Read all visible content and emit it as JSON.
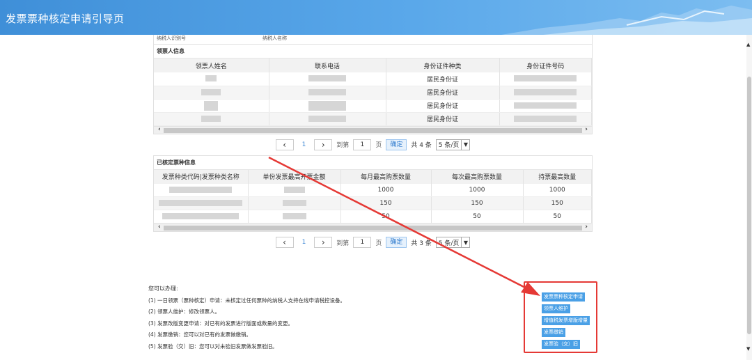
{
  "header": {
    "title": "发票票种核定申请引导页"
  },
  "top_row": {
    "col1": "纳税人识别号",
    "col2": "纳税人名称"
  },
  "receiver": {
    "title": "领票人信息",
    "columns": [
      "领票人姓名",
      "联系电话",
      "身份证件种类",
      "身份证件号码"
    ],
    "rows": [
      {
        "id_type": "居民身份证"
      },
      {
        "id_type": "居民身份证"
      },
      {
        "id_type": "居民身份证"
      },
      {
        "id_type": "居民身份证"
      }
    ],
    "pager": {
      "page": "1",
      "goto_label": "到第",
      "page_input": "1",
      "page_unit": "页",
      "ok": "确定",
      "total": "共 4 条",
      "size": "5 条/页"
    }
  },
  "approved": {
    "title": "已核定票种信息",
    "columns": [
      "发票种类代码|发票种类名称",
      "单份发票最高开票金额",
      "每月最高购票数量",
      "每次最高购票数量",
      "持票最高数量"
    ],
    "rows": [
      {
        "monthly": "1000",
        "each": "1000",
        "hold": "1000"
      },
      {
        "monthly": "150",
        "each": "150",
        "hold": "150"
      },
      {
        "monthly": "50",
        "each": "50",
        "hold": "50"
      }
    ],
    "pager": {
      "page": "1",
      "goto_label": "到第",
      "page_input": "1",
      "page_unit": "页",
      "ok": "确定",
      "total": "共 3 条",
      "size": "5 条/页"
    }
  },
  "guide": {
    "heading": "您可以办理:",
    "items": [
      "(1) 一日领票（票种核定）申请：未核定过任何票种的纳税人支持在线申请税控设备。",
      "(2) 领票人维护：修改领票人。",
      "(3) 发票改版变更申请：对已有的发票进行版面或数量的变更。",
      "(4) 发票缴销：您可以对已有的发票做缴销。",
      "(5) 发票验（交）旧：您可以对未验旧发票做发票验旧。"
    ]
  },
  "actions": [
    "发票票种核定申请",
    "领票人维护",
    "增值税发票增版增量",
    "发票缴销",
    "发票验（交）旧"
  ],
  "colors": {
    "accent": "#4aa0e6",
    "highlight": "#e53935"
  }
}
